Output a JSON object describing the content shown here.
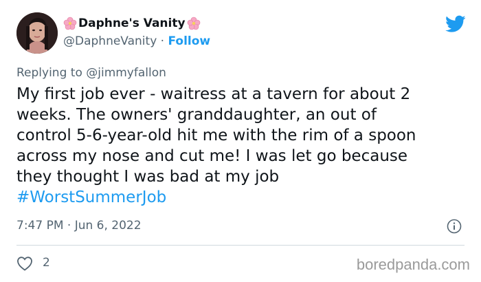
{
  "tweet": {
    "display_name": "Daphne's Vanity",
    "handle": "@DaphneVanity",
    "separator": " · ",
    "follow_label": "Follow",
    "replying_to": "Replying to @jimmyfallon",
    "body_lines": [
      "My first job ever - waitress at a tavern for about 2",
      "weeks. The owners' granddaughter, an out of",
      "control 5-6-year-old hit me with the rim of a spoon",
      "across my nose and cut me! I was let go because",
      "they thought I was bad at my job"
    ],
    "hashtag": "#WorstSummerJob",
    "timestamp": "7:47 PM · Jun 6, 2022",
    "like_count": "2"
  },
  "icons": {
    "brand": "twitter-bird-icon",
    "like": "heart-outline-icon",
    "info": "info-circle-icon",
    "name_decoration": "cherry-blossom-icon"
  },
  "colors": {
    "accent": "#1d9bf0",
    "secondary_text": "#536471",
    "primary_text": "#0f1419",
    "divider": "#cfd9de",
    "watermark": "#9a9a9a"
  },
  "watermark": {
    "text": "boredpanda.com"
  }
}
